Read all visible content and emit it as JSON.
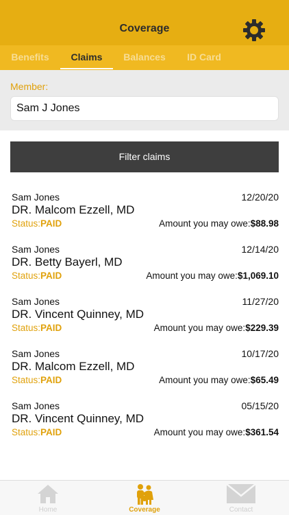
{
  "header": {
    "title": "Coverage",
    "settings_icon": "gear-icon"
  },
  "tabs": [
    {
      "label": "Benefits",
      "active": false
    },
    {
      "label": "Claims",
      "active": true
    },
    {
      "label": "Balances",
      "active": false
    },
    {
      "label": "ID Card",
      "active": false
    }
  ],
  "member": {
    "label": "Member:",
    "value": "Sam J Jones"
  },
  "filter": {
    "label": "Filter claims"
  },
  "claims": [
    {
      "patient": "Sam Jones",
      "date": "12/20/20",
      "doctor": "DR. Malcom Ezzell, MD",
      "status_label": "Status:",
      "status": "PAID",
      "amount_label": "Amount you may owe:",
      "amount": "$88.98"
    },
    {
      "patient": "Sam Jones",
      "date": "12/14/20",
      "doctor": "DR. Betty Bayerl, MD",
      "status_label": "Status:",
      "status": "PAID",
      "amount_label": "Amount you may owe:",
      "amount": "$1,069.10"
    },
    {
      "patient": "Sam Jones",
      "date": "11/27/20",
      "doctor": "DR. Vincent Quinney, MD",
      "status_label": "Status:",
      "status": "PAID",
      "amount_label": "Amount you may owe:",
      "amount": "$229.39"
    },
    {
      "patient": "Sam Jones",
      "date": "10/17/20",
      "doctor": "DR. Malcom Ezzell, MD",
      "status_label": "Status:",
      "status": "PAID",
      "amount_label": "Amount you may owe:",
      "amount": "$65.49"
    },
    {
      "patient": "Sam Jones",
      "date": "05/15/20",
      "doctor": "DR. Vincent Quinney, MD",
      "status_label": "Status:",
      "status": "PAID",
      "amount_label": "Amount you may owe:",
      "amount": "$361.54"
    }
  ],
  "bottom_nav": [
    {
      "label": "Home",
      "icon": "home-icon",
      "active": false
    },
    {
      "label": "Coverage",
      "icon": "family-icon",
      "active": true
    },
    {
      "label": "Contact",
      "icon": "envelope-icon",
      "active": false
    }
  ],
  "colors": {
    "header": "#e6ae12",
    "tabs": "#f0b921",
    "accent": "#e0a10b",
    "filter_button": "#3e3e3e"
  }
}
